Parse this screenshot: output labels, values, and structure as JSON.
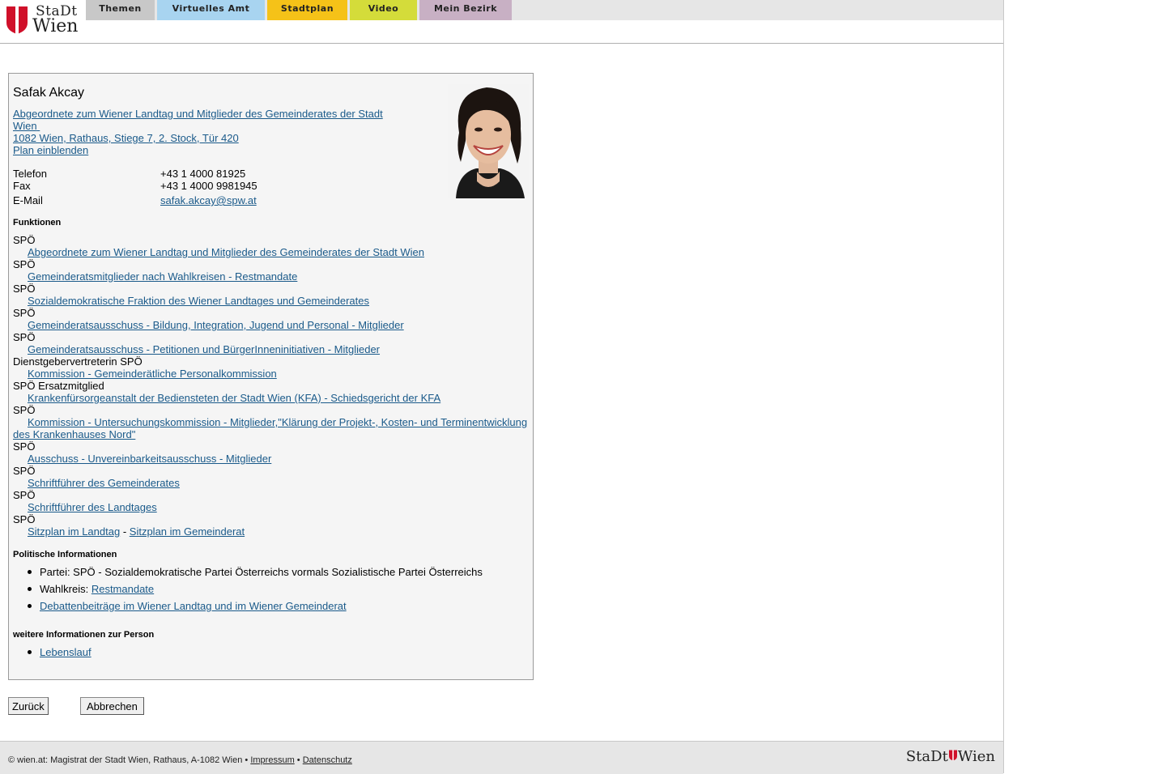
{
  "header": {
    "logo_top": "StaDt",
    "logo_bottom": "Wien",
    "tabs": [
      {
        "label": "Themen",
        "color": "#c8c8c8"
      },
      {
        "label": "Virtuelles Amt",
        "color": "#a8d4f0"
      },
      {
        "label": "Stadtplan",
        "color": "#f5c218"
      },
      {
        "label": "Video",
        "color": "#d4dc3a"
      },
      {
        "label": "Mein Bezirk",
        "color": "#c8b0c4"
      }
    ]
  },
  "person": {
    "name": "Safak Akcay",
    "role_line1": "Abgeordnete zum Wiener Landtag und Mitglieder des Gemeinderates der Stadt",
    "role_line2": "Wien",
    "address": "1082 Wien, Rathaus, Stiege 7, 2. Stock, Tür 420",
    "plan_link": "Plan einblenden",
    "contact": [
      {
        "label": "Telefon",
        "value": "+43 1 4000 81925"
      },
      {
        "label": "Fax",
        "value": "+43 1 4000 9981945"
      },
      {
        "label": "E-Mail",
        "value": "safak.akcay@spw.at"
      }
    ]
  },
  "functions": {
    "title": "Funktionen",
    "items": [
      {
        "org": "SPÖ",
        "link": "Abgeordnete zum Wiener Landtag und Mitglieder des Gemeinderates der Stadt Wien"
      },
      {
        "org": "SPÖ",
        "link": "Gemeinderatsmitglieder nach Wahlkreisen - Restmandate"
      },
      {
        "org": "SPÖ",
        "link": "Sozialdemokratische Fraktion des Wiener Landtages und Gemeinderates"
      },
      {
        "org": "SPÖ",
        "link": "Gemeinderatsausschuss - Bildung, Integration, Jugend und Personal - Mitglieder"
      },
      {
        "org": "SPÖ",
        "link": "Gemeinderatsausschuss - Petitionen und BürgerInneninitiativen - Mitglieder"
      },
      {
        "org": "Dienstgebervertreterin SPÖ",
        "link": "Kommission - Gemeinderätliche Personalkommission"
      },
      {
        "org": "SPÖ Ersatzmitglied",
        "link": "Krankenfürsorgeanstalt der Bediensteten der Stadt Wien (KFA) - Schiedsgericht der KFA"
      },
      {
        "org": "SPÖ",
        "link": "Kommission - Untersuchungskommission - Mitglieder,\"Klärung der Projekt-, Kosten- und Terminentwicklung des Krankenhauses Nord\""
      },
      {
        "org": "SPÖ",
        "link": "Ausschuss - Unvereinbarkeitsausschuss - Mitglieder"
      },
      {
        "org": "SPÖ",
        "link": "Schriftführer des Gemeinderates"
      },
      {
        "org": "SPÖ",
        "link": "Schriftführer des Landtages"
      }
    ],
    "last_org": "SPÖ",
    "sitzplan_landtag": "Sitzplan im Landtag",
    "sitzplan_sep": "-",
    "sitzplan_gemeinderat": "Sitzplan im Gemeinderat"
  },
  "politics": {
    "title": "Politische Informationen",
    "partei": "Partei: SPÖ - Sozialdemokratische Partei Österreichs vormals Sozialistische Partei Österreichs",
    "wahlkreis_label": "Wahlkreis:",
    "wahlkreis_link": "Restmandate",
    "debatten": "Debattenbeiträge im Wiener Landtag und im Wiener Gemeinderat"
  },
  "more": {
    "title": "weitere Informationen zur Person",
    "lebenslauf": "Lebenslauf"
  },
  "buttons": {
    "back": "Zurück",
    "cancel": "Abbrechen"
  },
  "footer": {
    "copyright": "© wien.at: Magistrat der Stadt Wien, Rathaus, A-1082 Wien •",
    "impressum": "Impressum",
    "sep": "•",
    "datenschutz": "Datenschutz",
    "logo_left": "StaDt",
    "logo_right": "Wien"
  }
}
